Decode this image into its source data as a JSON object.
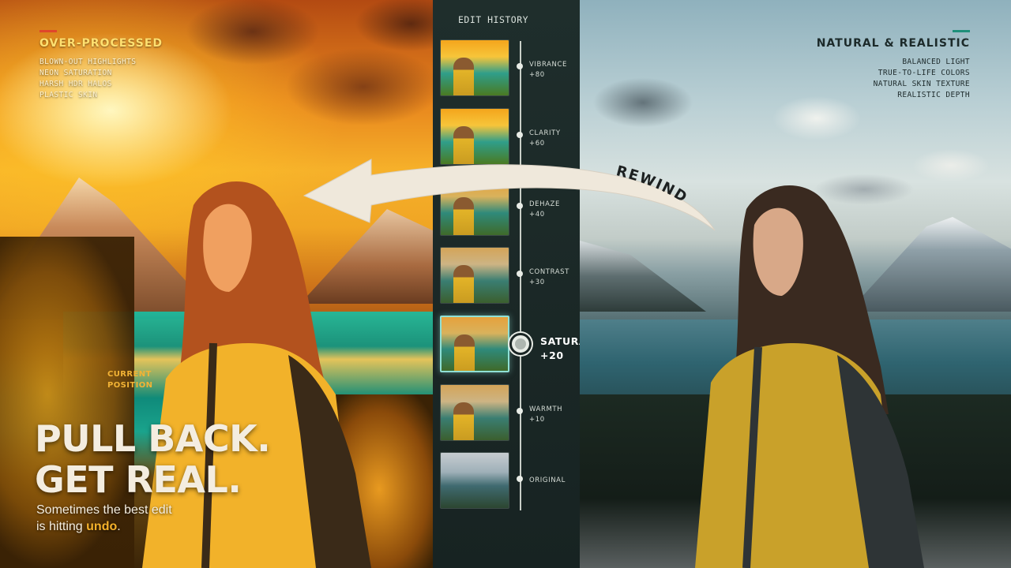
{
  "left": {
    "title": "OVER-PROCESSED",
    "items": [
      "BLOWN-OUT HIGHLIGHTS",
      "NEON SATURATION",
      "HARSH HDR HALOS",
      "PLASTIC SKIN"
    ],
    "headline_line1": "PULL BACK.",
    "headline_line2": "GET REAL.",
    "sub_line1": "Sometimes the best edit",
    "sub_line2_prefix": "is hitting ",
    "sub_highlight": "undo",
    "sub_suffix": "."
  },
  "right": {
    "title": "NATURAL & REALISTIC",
    "items": [
      "BALANCED LIGHT",
      "TRUE-TO-LIFE COLORS",
      "NATURAL SKIN TEXTURE",
      "REALISTIC DEPTH"
    ]
  },
  "history": {
    "title": "EDIT HISTORY",
    "steps": [
      {
        "name": "VIBRANCE",
        "value": "+80"
      },
      {
        "name": "CLARITY",
        "value": "+60"
      },
      {
        "name": "DEHAZE",
        "value": "+40"
      },
      {
        "name": "CONTRAST",
        "value": "+30"
      },
      {
        "name": "SATURATION",
        "value": "+20"
      },
      {
        "name": "WARMTH",
        "value": "+10"
      },
      {
        "name": "ORIGINAL",
        "value": ""
      }
    ],
    "current_line1": "CURRENT",
    "current_line2": "POSITION"
  },
  "arrow_label": "REWIND",
  "colors": {
    "accent_warm": "#f2b335",
    "accent_red": "#e0462a",
    "accent_teal": "#1f8f7a",
    "panel_bg": "#172322"
  }
}
